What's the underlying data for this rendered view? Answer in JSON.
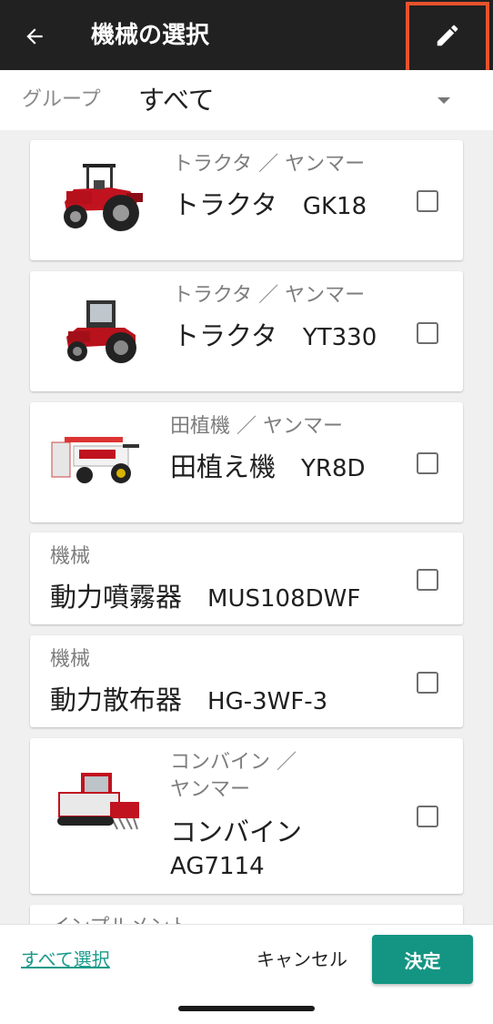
{
  "app_bar": {
    "title": "機械の選択",
    "back_icon": "arrow-back-icon",
    "edit_icon": "pencil-icon",
    "highlight_color": "#e8522e"
  },
  "group_filter": {
    "label": "グループ",
    "value": "すべて"
  },
  "machines": [
    {
      "category": "トラクタ ／ ヤンマー",
      "name": "トラクタ",
      "model": "GK18",
      "checked": false,
      "image": "red-tractor"
    },
    {
      "category": "トラクタ ／ ヤンマー",
      "name": "トラクタ",
      "model": "YT330",
      "checked": false,
      "image": "cab-tractor"
    },
    {
      "category": "田植機 ／ ヤンマー",
      "name": "田植え機",
      "model": "YR8D",
      "checked": false,
      "image": "rice-transplanter"
    },
    {
      "category": "機械",
      "name": "動力噴霧器",
      "model": "MUS108DWF",
      "checked": false
    },
    {
      "category": "機械",
      "name": "動力散布器",
      "model": "HG-3WF-3",
      "checked": false
    },
    {
      "category_line1": "コンバイン ／",
      "category_line2": "ヤンマー",
      "name": "コンバイン",
      "model": "AG7114",
      "checked": false,
      "image": "combine-harvester"
    },
    {
      "category": "インプルメント"
    }
  ],
  "bottom_bar": {
    "select_all": "すべて選択",
    "cancel": "キャンセル",
    "confirm": "決定",
    "accent_color": "#149583"
  }
}
